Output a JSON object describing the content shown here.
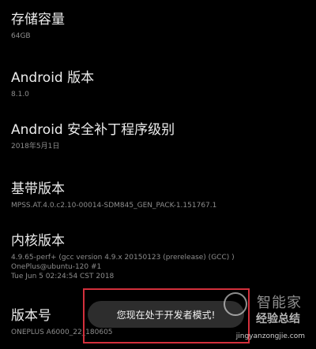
{
  "settings": {
    "items": [
      {
        "title": "存储容量",
        "value": "64GB"
      },
      {
        "title": "Android 版本",
        "value": "8.1.0"
      },
      {
        "title": "Android 安全补丁程序级别",
        "value": "2018年5月1日"
      },
      {
        "title": "基带版本",
        "value": "MPSS.AT.4.0.c2.10-00014-SDM845_GEN_PACK-1.151767.1"
      },
      {
        "title": "内核版本",
        "value_lines": [
          "4.9.65-perf+ (gcc version 4.9.x 20150123 (prerelease) (GCC) )",
          "OnePlus@ubuntu-120 #1",
          "Tue Jun 5 02:24:54 CST 2018"
        ]
      },
      {
        "title": "版本号",
        "value": "ONEPLUS A6000_22_180605"
      }
    ]
  },
  "toast": {
    "message": "您现在处于开发者模式!"
  },
  "watermark": {
    "brand": "智能家",
    "title": "经验总结",
    "url": "jingyanzongjie.com"
  }
}
